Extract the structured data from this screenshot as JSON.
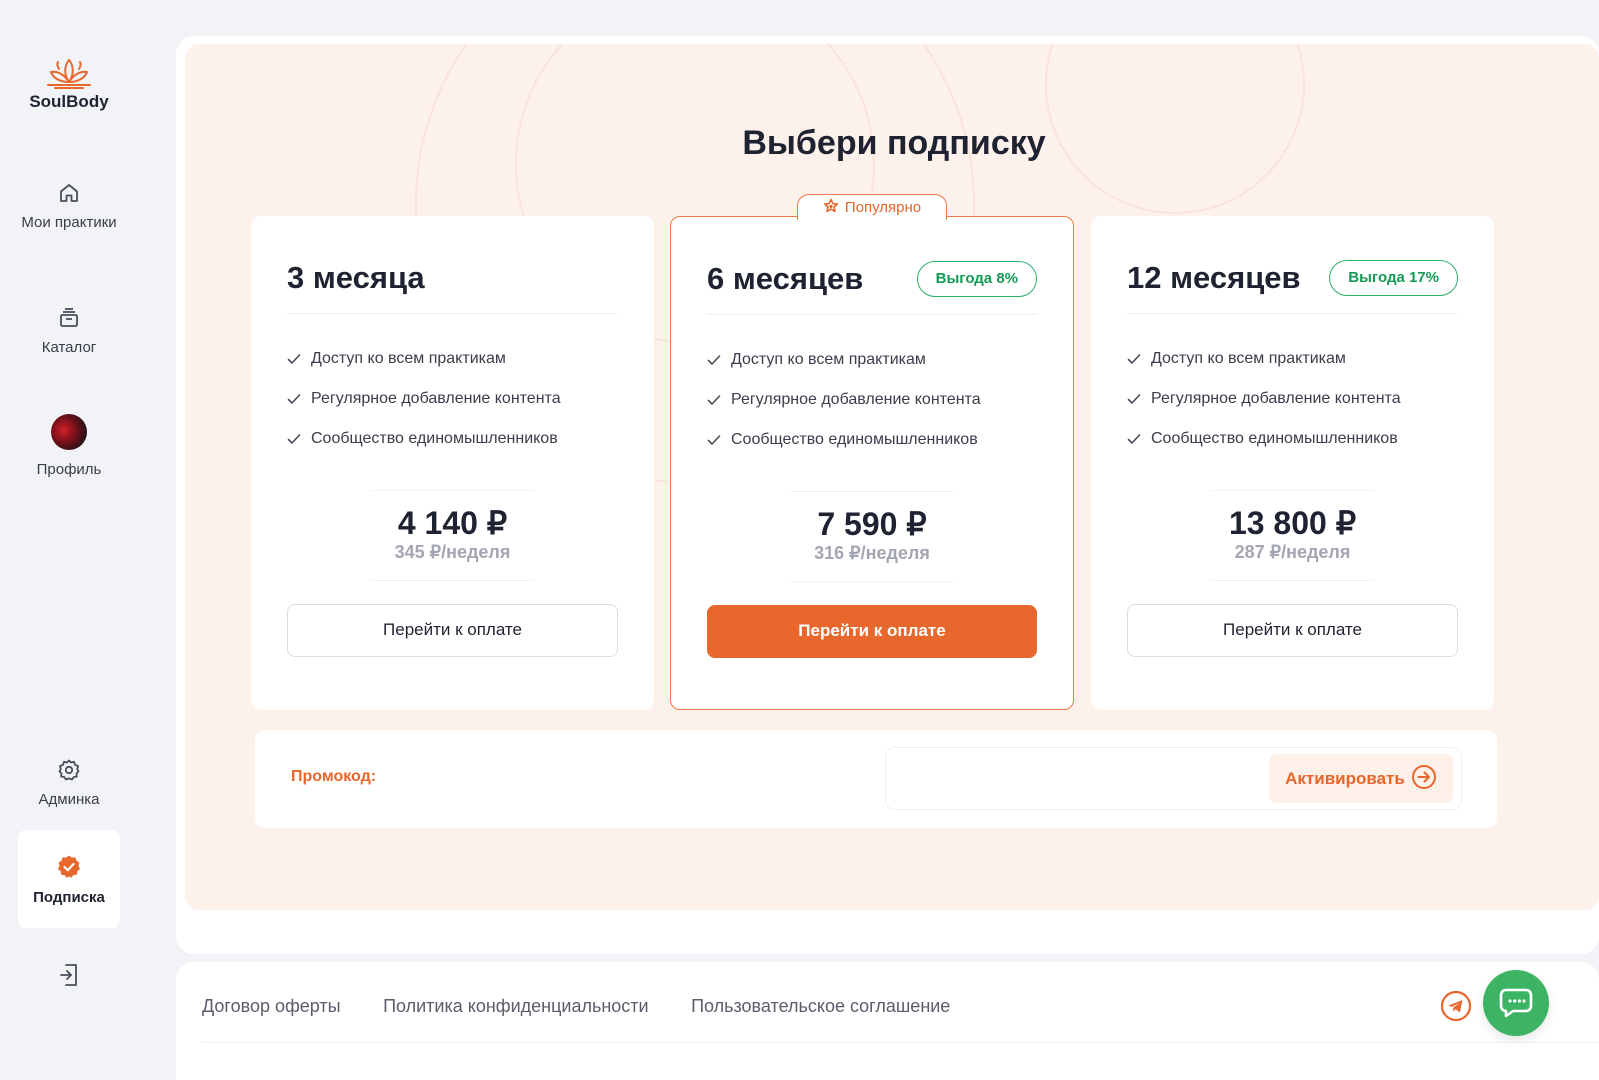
{
  "brand": {
    "name": "SoulBody",
    "accent": "#e8672d"
  },
  "sidebar": {
    "items": [
      {
        "label": "Мои практики",
        "icon": "home-icon"
      },
      {
        "label": "Каталог",
        "icon": "catalog-icon"
      },
      {
        "label": "Профиль",
        "icon": "avatar"
      },
      {
        "label": "Админка",
        "icon": "gear-icon"
      },
      {
        "label": "Подписка",
        "icon": "verified-badge-icon",
        "active": true
      }
    ],
    "logout_icon": "logout-icon"
  },
  "page": {
    "title": "Выбери подписку"
  },
  "plans": [
    {
      "title": "3 месяца",
      "badge": "",
      "features": [
        "Доступ ко всем практикам",
        "Регулярное добавление контента",
        "Сообщество единомышленников"
      ],
      "price": "4 140 ₽",
      "per_week": "345 ₽/неделя",
      "button": "Перейти к оплате"
    },
    {
      "title": "6 месяцев",
      "tag": "Популярно",
      "badge": "Выгода 8%",
      "features": [
        "Доступ ко всем практикам",
        "Регулярное добавление контента",
        "Сообщество единомышленников"
      ],
      "price": "7 590 ₽",
      "per_week": "316 ₽/неделя",
      "button": "Перейти к оплате"
    },
    {
      "title": "12 месяцев",
      "badge": "Выгода 17%",
      "features": [
        "Доступ ко всем практикам",
        "Регулярное добавление контента",
        "Сообщество единомышленников"
      ],
      "price": "13 800 ₽",
      "per_week": "287 ₽/неделя",
      "button": "Перейти к оплате"
    }
  ],
  "promo": {
    "label": "Промокод:",
    "value": "",
    "button": "Активировать"
  },
  "footer": {
    "links": [
      "Договор оферты",
      "Политика конфиденциальности",
      "Пользовательское соглашение"
    ]
  }
}
